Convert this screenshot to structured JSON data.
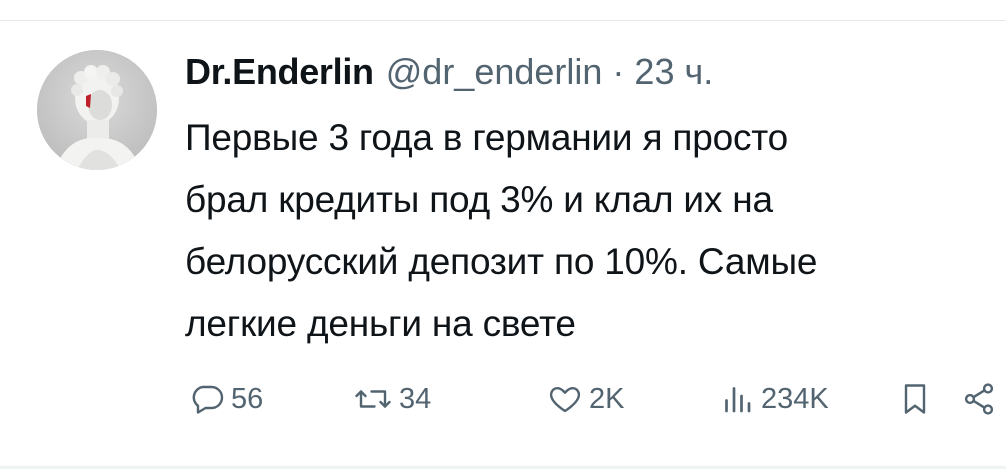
{
  "tweet": {
    "author": {
      "display_name": "Dr.Enderlin",
      "handle": "@dr_enderlin"
    },
    "separator": "·",
    "time": "23 ч.",
    "text_lines": [
      "Первые 3 года в германии я просто",
      "брал кредиты под 3% и клал их на",
      "белорусский депозит по 10%. Самые",
      "легкие деньги на свете"
    ],
    "actions": {
      "replies": "56",
      "retweets": "34",
      "likes": "2K",
      "views": "234K"
    }
  },
  "icons": {
    "reply": "reply-bubble-icon",
    "retweet": "retweet-arrows-icon",
    "like": "heart-icon",
    "views": "bar-chart-icon",
    "bookmark": "bookmark-icon",
    "share": "share-icon"
  },
  "colors": {
    "text_primary": "#0f1419",
    "text_secondary": "#536471",
    "divider": "#e6e9ec"
  }
}
